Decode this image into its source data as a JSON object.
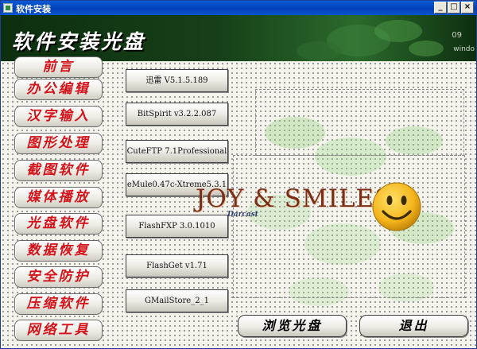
{
  "window": {
    "title": "软件安装",
    "buttons": {
      "minimize": "_",
      "maximize": "□",
      "close": "×"
    }
  },
  "banner": {
    "title": "软件安装光盘",
    "corner_text_1": "09",
    "corner_text_2": "windo"
  },
  "sidebar": {
    "items": [
      {
        "label": "前言"
      },
      {
        "label": "办公编辑"
      },
      {
        "label": "汉字输入"
      },
      {
        "label": "图形处理"
      },
      {
        "label": "截图软件"
      },
      {
        "label": "媒体播放"
      },
      {
        "label": "光盘软件"
      },
      {
        "label": "数据恢复"
      },
      {
        "label": "安全防护"
      },
      {
        "label": "压缩软件"
      },
      {
        "label": "网络工具"
      }
    ]
  },
  "software": {
    "items": [
      {
        "label": "迅雷 V5.1.5.189"
      },
      {
        "label": "BitSpirit v3.2.2.087"
      },
      {
        "label": "CuteFTP 7.1Professional"
      },
      {
        "label": "eMule0.47c-Xtreme5.3.1"
      },
      {
        "label": "FlashFXP 3.0.1010"
      },
      {
        "label": "FlashGet v1.71"
      },
      {
        "label": "GMailStore_2_1"
      }
    ]
  },
  "decor": {
    "slogan": "JOY & SMILES",
    "sub": "Darcast"
  },
  "actions": {
    "browse_label": "浏览光盘",
    "exit_label": "退出"
  },
  "colors": {
    "title_blue": "#0141b8",
    "banner_green": "#163f18",
    "sidebar_text_red": "#d4121a",
    "smiley_yellow": "#f4b51c"
  }
}
